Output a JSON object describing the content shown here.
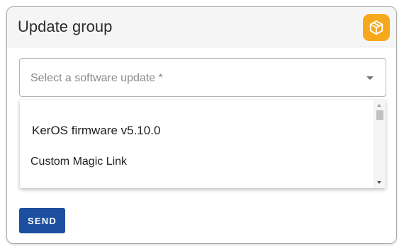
{
  "card": {
    "title": "Update group",
    "badge_icon": "cube-icon",
    "badge_color": "#f6a81c"
  },
  "select": {
    "placeholder": "Select a software update *",
    "icon": "caret-down-icon"
  },
  "dropdown": {
    "options": [
      {
        "label": "KerOS firmware v5.10.0"
      },
      {
        "label": "Custom Magic Link"
      }
    ]
  },
  "actions": {
    "send_label": "SEND",
    "send_color": "#1c4fa0"
  }
}
